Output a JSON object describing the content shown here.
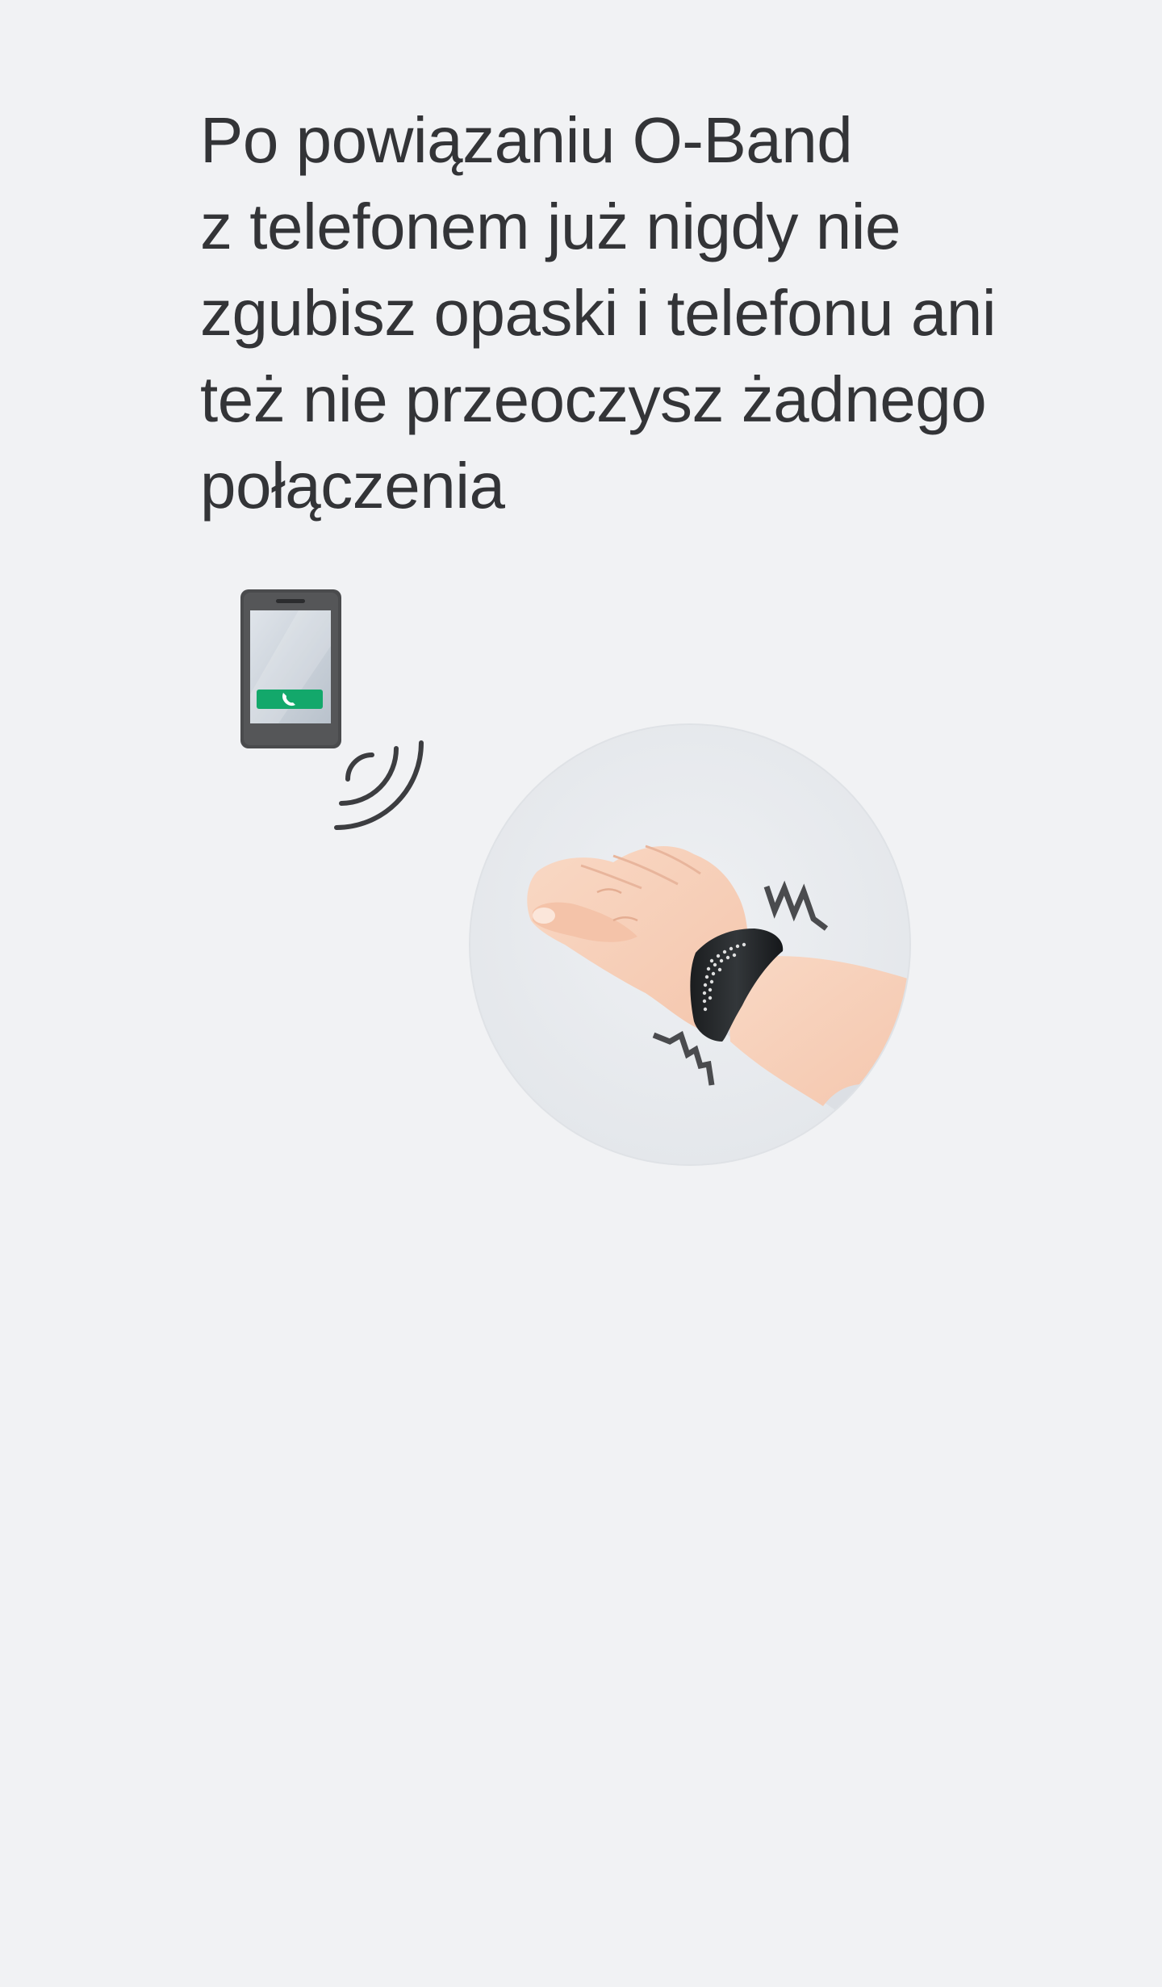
{
  "headline": {
    "lines": [
      "Po powiązaniu O-Band",
      "z telefonem już nigdy nie",
      "zgubisz opaski i telefonu ani",
      "też nie przeoczysz żadnego",
      "połączenia"
    ]
  },
  "illustration": {
    "phone_icon": "phone-with-incoming-call-icon",
    "signal_icon": "wireless-signal-waves-icon",
    "band_icon": "o-band-wristband-on-hand-icon",
    "vibration_icon": "vibration-zigzag-icon"
  },
  "colors": {
    "background": "#f1f2f4",
    "text": "#333437",
    "call_accent": "#13a86b",
    "circle": "#e9ebee"
  }
}
